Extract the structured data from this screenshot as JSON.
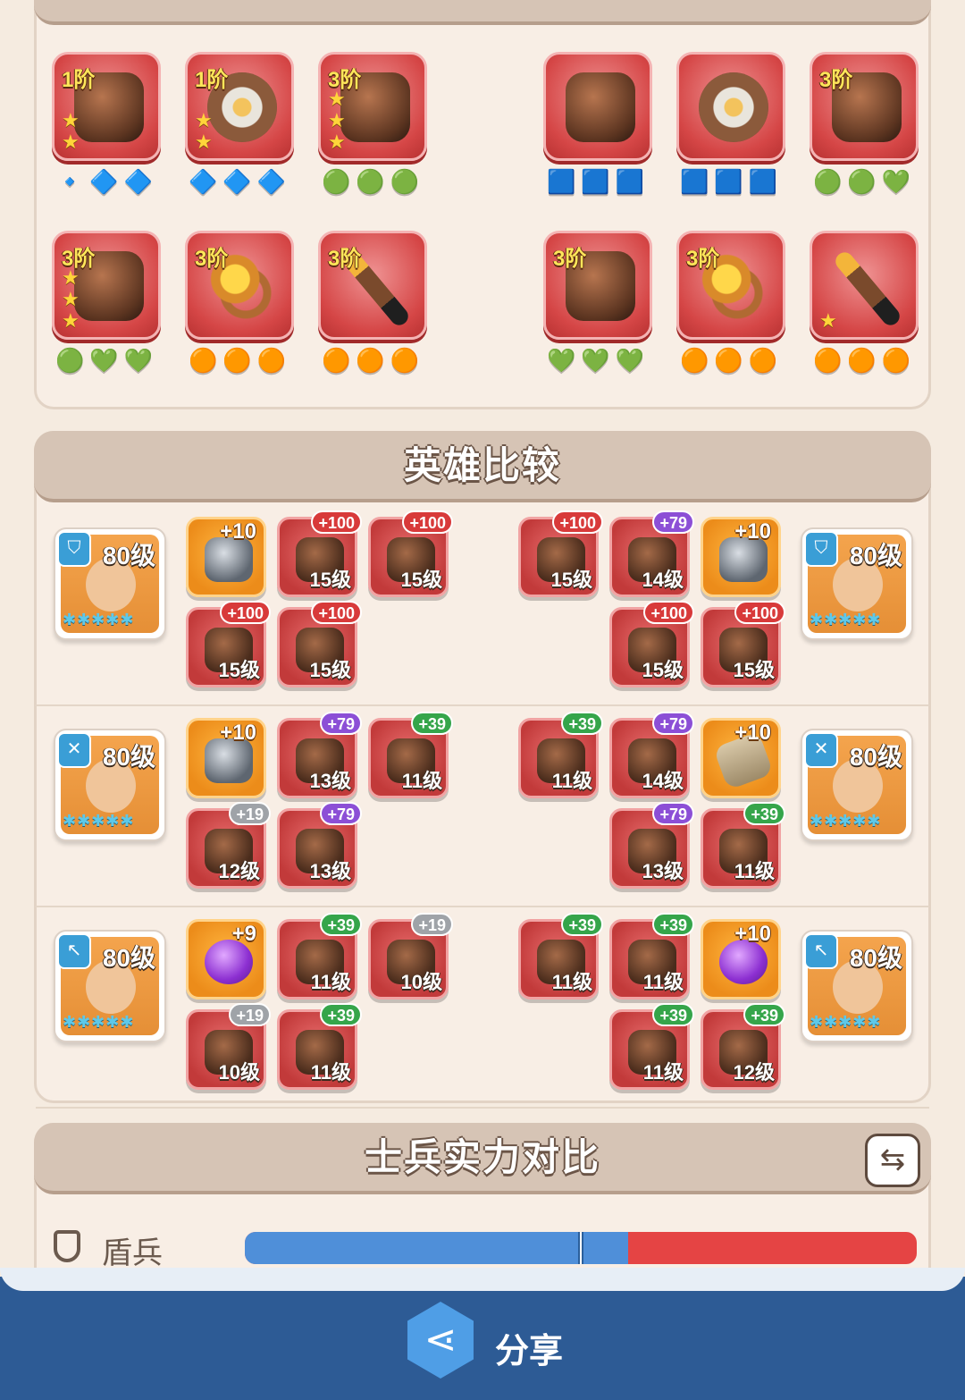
{
  "section_equipment": {
    "left": [
      {
        "tier": "1阶",
        "stars": "★★",
        "gems": "🔹🔷🔷",
        "kind": "helmet"
      },
      {
        "tier": "1阶",
        "stars": "★★",
        "gems": "🔷🔷🔷",
        "kind": "shield"
      },
      {
        "tier": "3阶",
        "stars": "★★★",
        "gems": "🟢🟢🟢",
        "kind": "armor"
      },
      {
        "tier": "3阶",
        "stars": "★★★",
        "gems": "🟢💚💚",
        "kind": "armor"
      },
      {
        "tier": "3阶",
        "stars": "",
        "gems": "🟠🟠🟠",
        "kind": "ring"
      },
      {
        "tier": "3阶",
        "stars": "",
        "gems": "🟠🟠🟠",
        "kind": "staff"
      }
    ],
    "right": [
      {
        "tier": "",
        "stars": "",
        "gems": "🟦🟦🟦",
        "kind": "helmet"
      },
      {
        "tier": "",
        "stars": "",
        "gems": "🟦🟦🟦",
        "kind": "shield"
      },
      {
        "tier": "3阶",
        "stars": "",
        "gems": "🟢🟢💚",
        "kind": "armor"
      },
      {
        "tier": "3阶",
        "stars": "",
        "gems": "💚💚💚",
        "kind": "armor"
      },
      {
        "tier": "3阶",
        "stars": "",
        "gems": "🟠🟠🟠",
        "kind": "ring"
      },
      {
        "tier": "",
        "stars": "★",
        "gems": "🟠🟠🟠",
        "kind": "staff"
      }
    ]
  },
  "section_hero": {
    "title": "英雄比较",
    "rows": [
      {
        "left_hero": {
          "level": "80级",
          "class_icon": "shield-icon",
          "stars": "✱✱✱✱✱"
        },
        "right_hero": {
          "level": "80级",
          "class_icon": "shield-icon",
          "stars": "✱✱✱✱✱"
        },
        "left_items": [
          {
            "bonus": "+10",
            "level": "",
            "color": "orange",
            "badge": "plain"
          },
          {
            "bonus": "+100",
            "level": "15级",
            "color": "red",
            "badge": "b100"
          },
          {
            "bonus": "+100",
            "level": "15级",
            "color": "red",
            "badge": "b100"
          },
          {
            "bonus": "+100",
            "level": "15级",
            "color": "red",
            "badge": "b100"
          },
          {
            "bonus": "+100",
            "level": "15级",
            "color": "red",
            "badge": "b100"
          }
        ],
        "right_items": [
          {
            "bonus": "+100",
            "level": "15级",
            "color": "red",
            "badge": "b100"
          },
          {
            "bonus": "+79",
            "level": "14级",
            "color": "red",
            "badge": "b79"
          },
          {
            "bonus": "+10",
            "level": "",
            "color": "orange",
            "badge": "plain"
          },
          {
            "bonus": "+100",
            "level": "15级",
            "color": "red",
            "badge": "b100"
          },
          {
            "bonus": "+100",
            "level": "15级",
            "color": "red",
            "badge": "b100"
          }
        ]
      },
      {
        "left_hero": {
          "level": "80级",
          "class_icon": "crossbow-icon",
          "stars": "✱✱✱✱✱"
        },
        "right_hero": {
          "level": "80级",
          "class_icon": "crossbow-icon",
          "stars": "✱✱✱✱✱"
        },
        "left_items": [
          {
            "bonus": "+10",
            "level": "",
            "color": "orange",
            "badge": "plain"
          },
          {
            "bonus": "+79",
            "level": "13级",
            "color": "red",
            "badge": "b79"
          },
          {
            "bonus": "+39",
            "level": "11级",
            "color": "red",
            "badge": "b39"
          },
          {
            "bonus": "+19",
            "level": "12级",
            "color": "red",
            "badge": "b19"
          },
          {
            "bonus": "+79",
            "level": "13级",
            "color": "red",
            "badge": "b79"
          }
        ],
        "right_items": [
          {
            "bonus": "+39",
            "level": "11级",
            "color": "red",
            "badge": "b39"
          },
          {
            "bonus": "+79",
            "level": "14级",
            "color": "red",
            "badge": "b79"
          },
          {
            "bonus": "+10",
            "level": "",
            "color": "orange",
            "badge": "plain"
          },
          {
            "bonus": "+79",
            "level": "13级",
            "color": "red",
            "badge": "b79"
          },
          {
            "bonus": "+39",
            "level": "11级",
            "color": "red",
            "badge": "b39"
          }
        ]
      },
      {
        "left_hero": {
          "level": "80级",
          "class_icon": "wand-icon",
          "stars": "✱✱✱✱✱"
        },
        "right_hero": {
          "level": "80级",
          "class_icon": "wand-icon",
          "stars": "✱✱✱✱✱"
        },
        "left_items": [
          {
            "bonus": "+9",
            "level": "",
            "color": "orange",
            "badge": "plain"
          },
          {
            "bonus": "+39",
            "level": "11级",
            "color": "red",
            "badge": "b39"
          },
          {
            "bonus": "+19",
            "level": "10级",
            "color": "red",
            "badge": "b19"
          },
          {
            "bonus": "+19",
            "level": "10级",
            "color": "red",
            "badge": "b19"
          },
          {
            "bonus": "+39",
            "level": "11级",
            "color": "red",
            "badge": "b39"
          }
        ],
        "right_items": [
          {
            "bonus": "+39",
            "level": "11级",
            "color": "red",
            "badge": "b39"
          },
          {
            "bonus": "+39",
            "level": "11级",
            "color": "red",
            "badge": "b39"
          },
          {
            "bonus": "+10",
            "level": "",
            "color": "orange",
            "badge": "plain"
          },
          {
            "bonus": "+39",
            "level": "11级",
            "color": "red",
            "badge": "b39"
          },
          {
            "bonus": "+39",
            "level": "12级",
            "color": "red",
            "badge": "b39"
          }
        ]
      }
    ]
  },
  "section_soldier": {
    "title": "士兵实力对比",
    "swap_icon": "swap-arrows-icon",
    "rows": [
      {
        "label": "盾兵",
        "icon": "shield-icon",
        "blue_fraction": 0.57,
        "marker_fraction": 0.5
      }
    ]
  },
  "footer": {
    "share_label": "分享",
    "share_icon": "share-icon"
  },
  "colors": {
    "accent_blue": "#4f8fd9",
    "accent_red": "#e54444",
    "footer_bg": "#2d5b95"
  }
}
